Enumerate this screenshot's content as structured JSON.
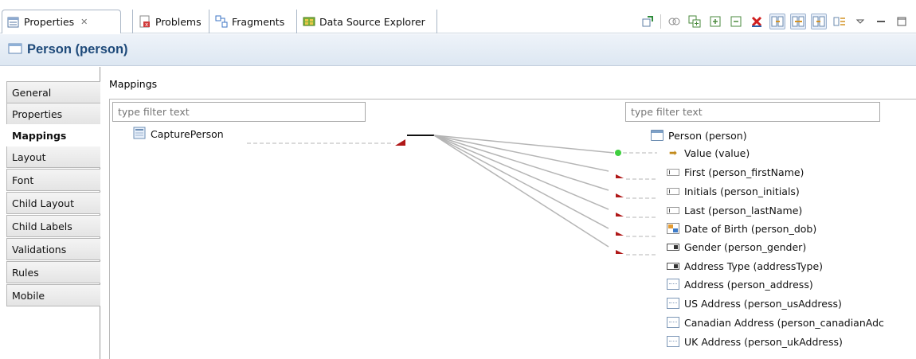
{
  "tabs": [
    {
      "label": "Properties",
      "close": "✕",
      "icon": "properties-icon"
    },
    {
      "label": "Problems",
      "icon": "problems-icon"
    },
    {
      "label": "Fragments",
      "icon": "fragments-icon"
    },
    {
      "label": "Data Source Explorer",
      "icon": "data-source-explorer-icon"
    }
  ],
  "toolbar": {
    "icons": [
      "link-icon",
      "mapping-icon",
      "expand-all-icon",
      "expand-icon",
      "collapse-icon",
      "delete-mapping-icon",
      "show-left-icon",
      "show-both-icon",
      "show-right-icon",
      "filter-icon",
      "view-menu-icon",
      "minimize-icon",
      "maximize-icon"
    ]
  },
  "header": {
    "title": "Person (person)"
  },
  "nav": {
    "items": [
      "General",
      "Properties",
      "Mappings",
      "Layout",
      "Font",
      "Child Layout",
      "Child Labels",
      "Validations",
      "Rules",
      "Mobile"
    ],
    "active": "Mappings"
  },
  "mappings": {
    "label": "Mappings",
    "left_filter_placeholder": "type filter text",
    "right_filter_placeholder": "type filter text",
    "source": {
      "label": "CapturePerson",
      "icon": "process-icon"
    },
    "target": [
      {
        "label": "Person (person)",
        "icon": "form-icon"
      },
      {
        "label": "Value (value)",
        "icon": "value-arrow-icon"
      },
      {
        "label": "First (person_firstName)",
        "icon": "text-field-icon"
      },
      {
        "label": "Initials (person_initials)",
        "icon": "text-field-icon"
      },
      {
        "label": "Last (person_lastName)",
        "icon": "text-field-icon"
      },
      {
        "label": "Date of Birth (person_dob)",
        "icon": "date-field-icon"
      },
      {
        "label": "Gender (person_gender)",
        "icon": "combo-field-icon"
      },
      {
        "label": "Address Type (addressType)",
        "icon": "combo-field-icon"
      },
      {
        "label": "Address (person_address)",
        "icon": "pane-icon"
      },
      {
        "label": "US Address (person_usAddress)",
        "icon": "pane-icon"
      },
      {
        "label": "Canadian Address (person_canadianAdc",
        "icon": "pane-icon"
      },
      {
        "label": "UK Address (person_ukAddress)",
        "icon": "pane-icon"
      }
    ]
  },
  "colors": {
    "header_title": "#1e4a7a",
    "wire": "#b5b5b5",
    "mapping_marker": "#b01818",
    "connected_dot": "#3fcf3f"
  }
}
